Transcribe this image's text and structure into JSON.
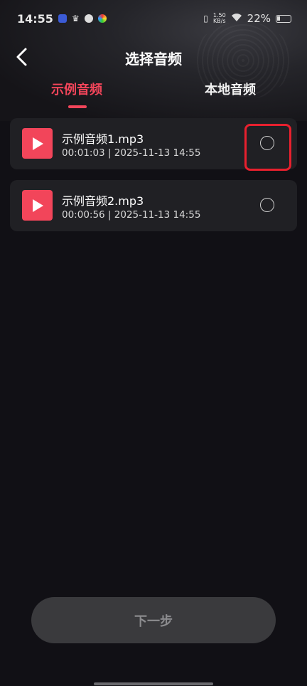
{
  "statusbar": {
    "time": "14:55",
    "net_speed_top": "1.50",
    "net_speed_bottom": "KB/s",
    "battery": "22%"
  },
  "header": {
    "title": "选择音频"
  },
  "tabs": [
    {
      "label": "示例音频",
      "active": true
    },
    {
      "label": "本地音频",
      "active": false
    }
  ],
  "files": [
    {
      "name": "示例音频1.mp3",
      "meta": "00:01:03  |  2025-11-13 14:55",
      "selected": false
    },
    {
      "name": "示例音频2.mp3",
      "meta": "00:00:56  |  2025-11-13 14:55",
      "selected": false
    }
  ],
  "next_button": {
    "label": "下一步",
    "enabled": false
  },
  "colors": {
    "accent": "#f2455a",
    "background": "#111015",
    "card": "#202024",
    "highlight": "#e8202e"
  },
  "icons": [
    "back-icon",
    "play-icon",
    "radio-icon"
  ]
}
